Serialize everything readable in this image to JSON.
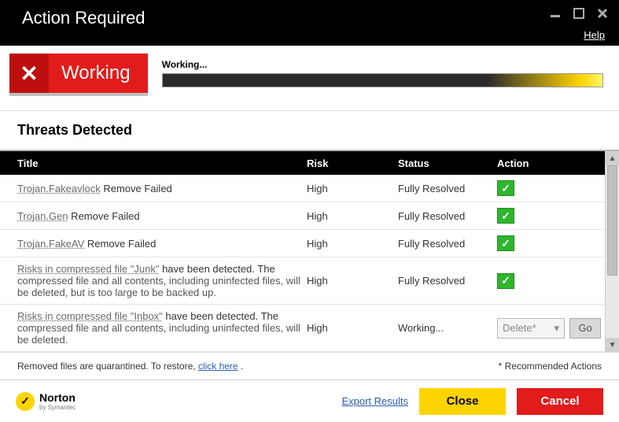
{
  "titlebar": {
    "title": "Action Required",
    "help": "Help"
  },
  "status": {
    "badge": "Working",
    "progress_label": "Working..."
  },
  "threats_heading": "Threats Detected",
  "columns": {
    "title": "Title",
    "risk": "Risk",
    "status": "Status",
    "action": "Action"
  },
  "rows": [
    {
      "link": "Trojan.Fakeavlock",
      "suffix": " Remove Failed",
      "desc": "",
      "risk": "High",
      "status": "Fully Resolved",
      "action_type": "check"
    },
    {
      "link": "Trojan.Gen",
      "suffix": " Remove Failed",
      "desc": "",
      "risk": "High",
      "status": "Fully Resolved",
      "action_type": "check"
    },
    {
      "link": "Trojan.FakeAV",
      "suffix": " Remove Failed",
      "desc": "",
      "risk": "High",
      "status": "Fully Resolved",
      "action_type": "check"
    },
    {
      "link": "Risks in compressed file \"Junk\"",
      "suffix": " have been detected. The",
      "desc": "compressed file and all contents, including uninfected files, will be deleted, but is too large to be backed up.",
      "risk": "High",
      "status": "Fully Resolved",
      "action_type": "check"
    },
    {
      "link": "Risks in compressed file \"Inbox\"",
      "suffix": " have been detected. The",
      "desc": "compressed file and all contents, including uninfected files, will be deleted.",
      "risk": "High",
      "status": "Working...",
      "action_type": "select",
      "select_value": "Delete*",
      "go_label": "Go"
    }
  ],
  "footer": {
    "note_prefix": "Removed files are quarantined. To restore, ",
    "note_link": "click here",
    "note_suffix": " .",
    "recommended": "* Recommended Actions"
  },
  "brand": {
    "name": "Norton",
    "sub": "by Symantec"
  },
  "buttons": {
    "export": "Export Results",
    "close": "Close",
    "cancel": "Cancel"
  }
}
